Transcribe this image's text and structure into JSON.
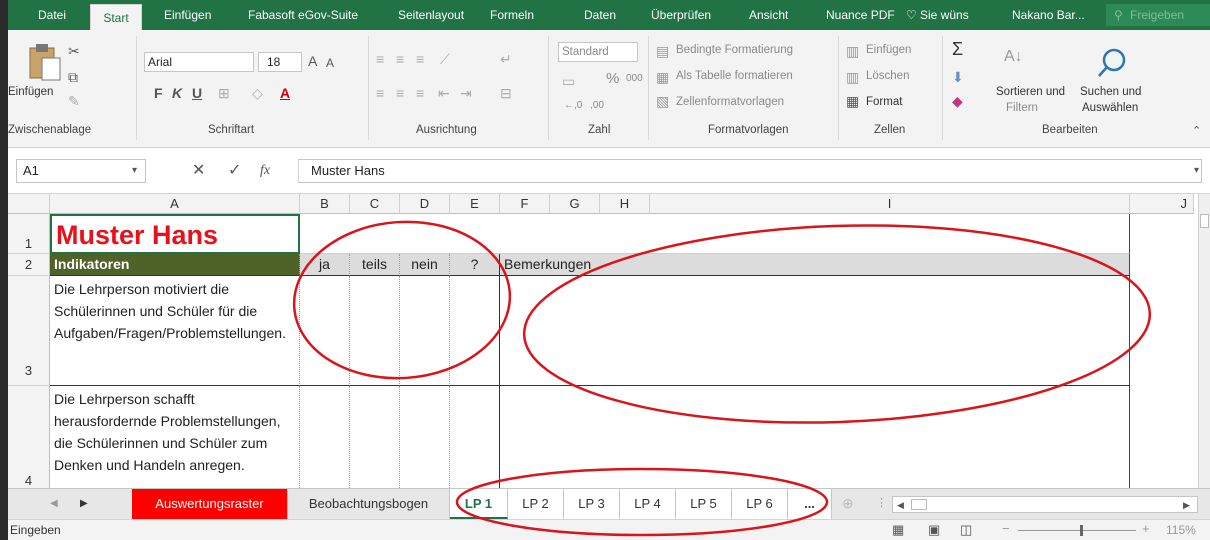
{
  "ribbon_tabs": [
    "Datei",
    "Start",
    "Einfügen",
    "Fabasoft eGov-Suite",
    "Seitenlayout",
    "Formeln",
    "Daten",
    "Überprüfen",
    "Ansicht",
    "Nuance PDF"
  ],
  "tell_me": "Sie wüns",
  "user_name": "Nakano Bar...",
  "share_label": "Freigeben",
  "clipboard": {
    "paste_label": "Einfügen",
    "group_label": "Zwischenablage"
  },
  "font": {
    "name": "Arial",
    "size": "18",
    "bold": "F",
    "italic": "K",
    "underline": "U",
    "group_label": "Schriftart"
  },
  "alignment": {
    "group_label": "Ausrichtung"
  },
  "number": {
    "format": "Standard",
    "percent": "%",
    "thousands": "000",
    "group_label": "Zahl"
  },
  "styles": {
    "conditional": "Bedingte Formatierung",
    "as_table": "Als Tabelle formatieren",
    "cell_styles": "Zellenformatvorlagen",
    "group_label": "Formatvorlagen"
  },
  "cells": {
    "insert": "Einfügen",
    "delete": "Löschen",
    "format": "Format",
    "group_label": "Zellen"
  },
  "editing": {
    "sort_line1": "Sortieren und",
    "sort_line2": "Filtern",
    "find_line1": "Suchen und",
    "find_line2": "Auswählen",
    "group_label": "Bearbeiten"
  },
  "formula_bar": {
    "name_box": "A1",
    "content": "Muster Hans",
    "fx": "fx"
  },
  "columns": [
    "A",
    "B",
    "C",
    "D",
    "E",
    "F",
    "G",
    "H",
    "I",
    "J"
  ],
  "rows": [
    "1",
    "2",
    "3",
    "4"
  ],
  "sheet": {
    "title": "Muster Hans",
    "header_indicators": "Indikatoren",
    "header_ja": "ja",
    "header_teils": "teils",
    "header_nein": "nein",
    "header_q": "?",
    "header_remarks": "Bemerkungen",
    "row3_text": "Die Lehrperson motiviert die Schülerinnen und Schüler für die Aufgaben/Fragen/Problemstellungen.",
    "row4_text": "Die Lehrperson schafft herausfordernde Problemstellungen, die Schülerinnen und Schüler zum Denken und Handeln anregen."
  },
  "sheet_tabs": [
    "Auswertungsraster",
    "Beobachtungsbogen",
    "LP 1",
    "LP 2",
    "LP 3",
    "LP 4",
    "LP 5",
    "LP 6",
    "..."
  ],
  "status": {
    "mode": "Eingeben",
    "zoom": "115%"
  },
  "colors": {
    "excel_green": "#217346",
    "title_red": "#e8101a",
    "header_green": "#4f6228",
    "annotation_red": "#d9151b",
    "tab_red": "#ff0000"
  }
}
